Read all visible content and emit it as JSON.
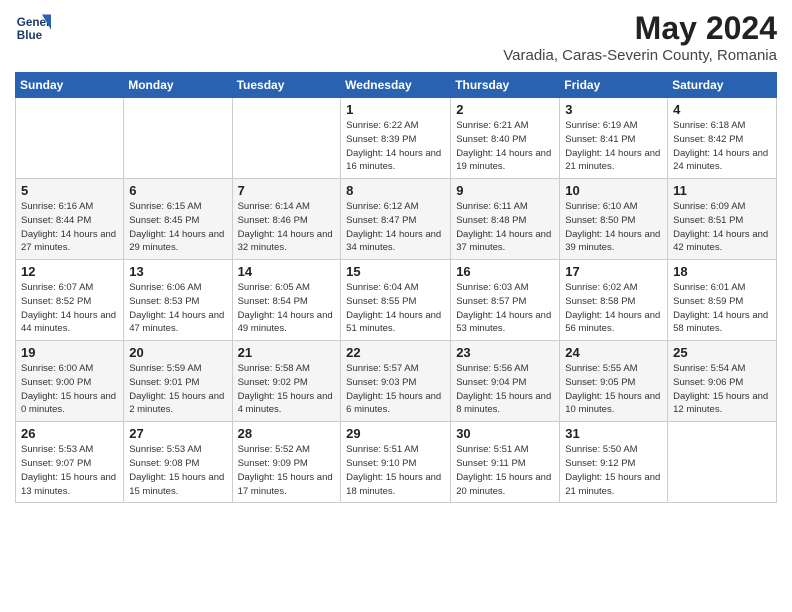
{
  "header": {
    "logo_line1": "General",
    "logo_line2": "Blue",
    "title": "May 2024",
    "subtitle": "Varadia, Caras-Severin County, Romania"
  },
  "weekdays": [
    "Sunday",
    "Monday",
    "Tuesday",
    "Wednesday",
    "Thursday",
    "Friday",
    "Saturday"
  ],
  "weeks": [
    [
      {
        "day": "",
        "info": ""
      },
      {
        "day": "",
        "info": ""
      },
      {
        "day": "",
        "info": ""
      },
      {
        "day": "1",
        "info": "Sunrise: 6:22 AM\nSunset: 8:39 PM\nDaylight: 14 hours and 16 minutes."
      },
      {
        "day": "2",
        "info": "Sunrise: 6:21 AM\nSunset: 8:40 PM\nDaylight: 14 hours and 19 minutes."
      },
      {
        "day": "3",
        "info": "Sunrise: 6:19 AM\nSunset: 8:41 PM\nDaylight: 14 hours and 21 minutes."
      },
      {
        "day": "4",
        "info": "Sunrise: 6:18 AM\nSunset: 8:42 PM\nDaylight: 14 hours and 24 minutes."
      }
    ],
    [
      {
        "day": "5",
        "info": "Sunrise: 6:16 AM\nSunset: 8:44 PM\nDaylight: 14 hours and 27 minutes."
      },
      {
        "day": "6",
        "info": "Sunrise: 6:15 AM\nSunset: 8:45 PM\nDaylight: 14 hours and 29 minutes."
      },
      {
        "day": "7",
        "info": "Sunrise: 6:14 AM\nSunset: 8:46 PM\nDaylight: 14 hours and 32 minutes."
      },
      {
        "day": "8",
        "info": "Sunrise: 6:12 AM\nSunset: 8:47 PM\nDaylight: 14 hours and 34 minutes."
      },
      {
        "day": "9",
        "info": "Sunrise: 6:11 AM\nSunset: 8:48 PM\nDaylight: 14 hours and 37 minutes."
      },
      {
        "day": "10",
        "info": "Sunrise: 6:10 AM\nSunset: 8:50 PM\nDaylight: 14 hours and 39 minutes."
      },
      {
        "day": "11",
        "info": "Sunrise: 6:09 AM\nSunset: 8:51 PM\nDaylight: 14 hours and 42 minutes."
      }
    ],
    [
      {
        "day": "12",
        "info": "Sunrise: 6:07 AM\nSunset: 8:52 PM\nDaylight: 14 hours and 44 minutes."
      },
      {
        "day": "13",
        "info": "Sunrise: 6:06 AM\nSunset: 8:53 PM\nDaylight: 14 hours and 47 minutes."
      },
      {
        "day": "14",
        "info": "Sunrise: 6:05 AM\nSunset: 8:54 PM\nDaylight: 14 hours and 49 minutes."
      },
      {
        "day": "15",
        "info": "Sunrise: 6:04 AM\nSunset: 8:55 PM\nDaylight: 14 hours and 51 minutes."
      },
      {
        "day": "16",
        "info": "Sunrise: 6:03 AM\nSunset: 8:57 PM\nDaylight: 14 hours and 53 minutes."
      },
      {
        "day": "17",
        "info": "Sunrise: 6:02 AM\nSunset: 8:58 PM\nDaylight: 14 hours and 56 minutes."
      },
      {
        "day": "18",
        "info": "Sunrise: 6:01 AM\nSunset: 8:59 PM\nDaylight: 14 hours and 58 minutes."
      }
    ],
    [
      {
        "day": "19",
        "info": "Sunrise: 6:00 AM\nSunset: 9:00 PM\nDaylight: 15 hours and 0 minutes."
      },
      {
        "day": "20",
        "info": "Sunrise: 5:59 AM\nSunset: 9:01 PM\nDaylight: 15 hours and 2 minutes."
      },
      {
        "day": "21",
        "info": "Sunrise: 5:58 AM\nSunset: 9:02 PM\nDaylight: 15 hours and 4 minutes."
      },
      {
        "day": "22",
        "info": "Sunrise: 5:57 AM\nSunset: 9:03 PM\nDaylight: 15 hours and 6 minutes."
      },
      {
        "day": "23",
        "info": "Sunrise: 5:56 AM\nSunset: 9:04 PM\nDaylight: 15 hours and 8 minutes."
      },
      {
        "day": "24",
        "info": "Sunrise: 5:55 AM\nSunset: 9:05 PM\nDaylight: 15 hours and 10 minutes."
      },
      {
        "day": "25",
        "info": "Sunrise: 5:54 AM\nSunset: 9:06 PM\nDaylight: 15 hours and 12 minutes."
      }
    ],
    [
      {
        "day": "26",
        "info": "Sunrise: 5:53 AM\nSunset: 9:07 PM\nDaylight: 15 hours and 13 minutes."
      },
      {
        "day": "27",
        "info": "Sunrise: 5:53 AM\nSunset: 9:08 PM\nDaylight: 15 hours and 15 minutes."
      },
      {
        "day": "28",
        "info": "Sunrise: 5:52 AM\nSunset: 9:09 PM\nDaylight: 15 hours and 17 minutes."
      },
      {
        "day": "29",
        "info": "Sunrise: 5:51 AM\nSunset: 9:10 PM\nDaylight: 15 hours and 18 minutes."
      },
      {
        "day": "30",
        "info": "Sunrise: 5:51 AM\nSunset: 9:11 PM\nDaylight: 15 hours and 20 minutes."
      },
      {
        "day": "31",
        "info": "Sunrise: 5:50 AM\nSunset: 9:12 PM\nDaylight: 15 hours and 21 minutes."
      },
      {
        "day": "",
        "info": ""
      }
    ]
  ]
}
